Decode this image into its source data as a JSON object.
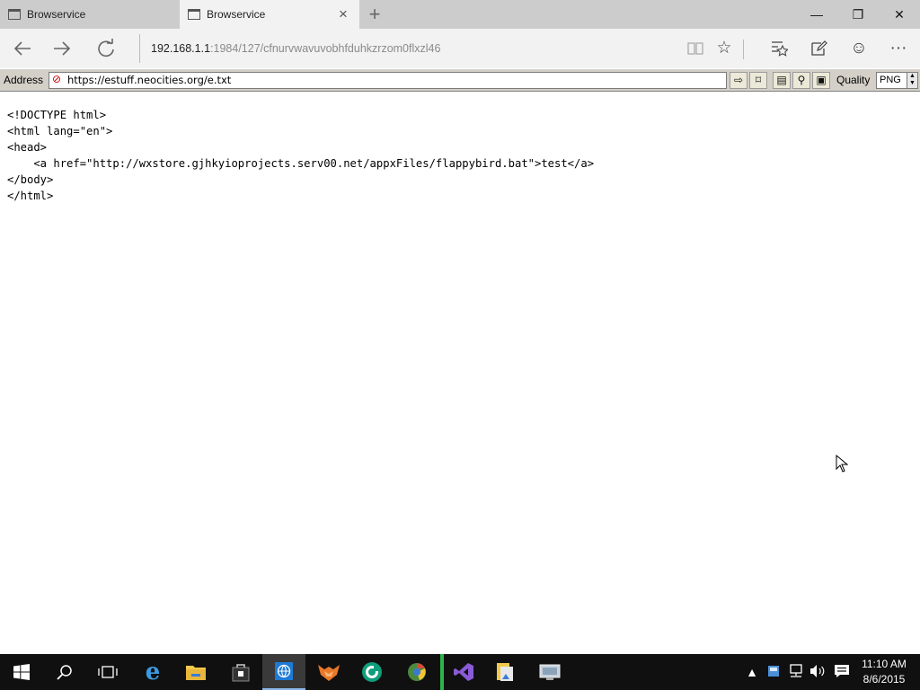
{
  "window": {
    "tabs": [
      {
        "title": "Browservice",
        "active": false
      },
      {
        "title": "Browservice",
        "active": true
      }
    ],
    "new_tab_glyph": "+",
    "controls": {
      "minimize": "—",
      "restore": "❐",
      "close": "✕"
    }
  },
  "nav": {
    "back_icon": "back-arrow-icon",
    "forward_icon": "forward-arrow-icon",
    "refresh_icon": "refresh-icon",
    "url_host": "192.168.1.1",
    "url_rest": ":1984/127/cfnurvwavuvobhfduhkzrzom0flxzl46",
    "reading_view_icon": "reading-view-icon",
    "favorite_icon": "star-icon",
    "hub_icon": "hub-icon",
    "note_icon": "web-note-icon",
    "feedback_icon": "smiley-icon",
    "more_label": "···"
  },
  "address_toolbar": {
    "label": "Address",
    "url": "https://estuff.neocities.org/e.txt",
    "go_icon": "go-arrow-icon",
    "quality_label": "Quality",
    "quality_value": "PNG"
  },
  "content": {
    "lines": [
      "<!DOCTYPE html>",
      "<html lang=\"en\">",
      "<head>",
      "    <a href=\"http://wxstore.gjhkyioprojects.serv00.net/appxFiles/flappybird.bat\">test</a>",
      "</body>",
      "</html>"
    ]
  },
  "taskbar": {
    "apps": [
      "start-icon",
      "search-icon",
      "task-view-icon",
      "edge-icon",
      "file-explorer-icon",
      "store-icon",
      "browservice-icon",
      "firefox-icon",
      "app-green-icon",
      "chrome-like-icon",
      "visual-studio-icon",
      "file-manager-icon",
      "desktop-app-icon"
    ],
    "clock_time": "11:10 AM",
    "clock_date": "8/6/2015"
  }
}
